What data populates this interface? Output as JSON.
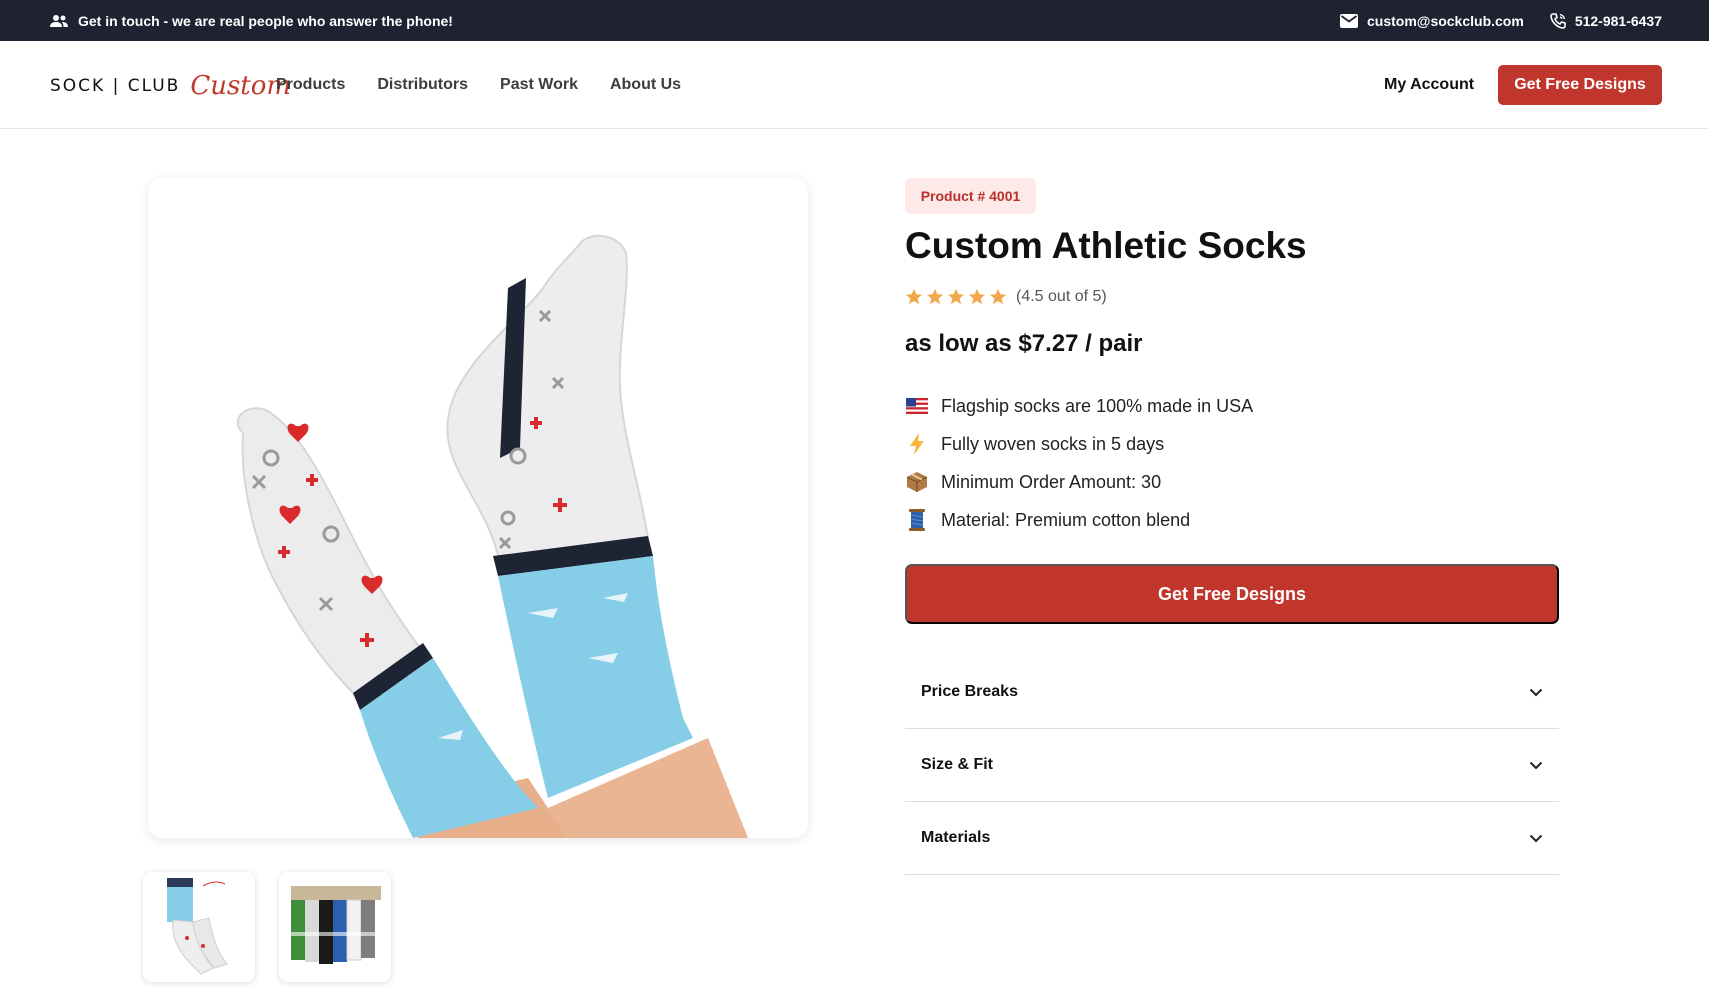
{
  "topbar": {
    "contact_message": "Get in touch - we are real people who answer the phone!",
    "email": "custom@sockclub.com",
    "phone": "512-981-6437"
  },
  "header": {
    "logo_text": "SOCK | CLUB",
    "logo_script": "Custom",
    "nav": [
      "Products",
      "Distributors",
      "Past Work",
      "About Us"
    ],
    "account_label": "My Account",
    "cta_label": "Get Free Designs"
  },
  "product": {
    "badge": "Product # 4001",
    "title": "Custom Athletic Socks",
    "rating_value": 4.5,
    "rating_text": "(4.5 out of 5)",
    "price": "as low as $7.27 / pair",
    "features": [
      {
        "icon": "us-flag-icon",
        "text": "Flagship socks are 100% made in USA"
      },
      {
        "icon": "lightning-icon",
        "text": "Fully woven socks in 5 days"
      },
      {
        "icon": "package-icon",
        "text": "Minimum Order Amount: 30"
      },
      {
        "icon": "thread-spool-icon",
        "text": "Material: Premium cotton blend"
      }
    ],
    "cta_label": "Get Free Designs",
    "accordion": [
      "Price Breaks",
      "Size & Fit",
      "Materials"
    ]
  },
  "colors": {
    "topbar_bg": "#1f2230",
    "brand_red": "#c0362c",
    "badge_bg": "#fde9e7",
    "star": "#f0a84a",
    "sock_blue": "#7fcbe8"
  }
}
